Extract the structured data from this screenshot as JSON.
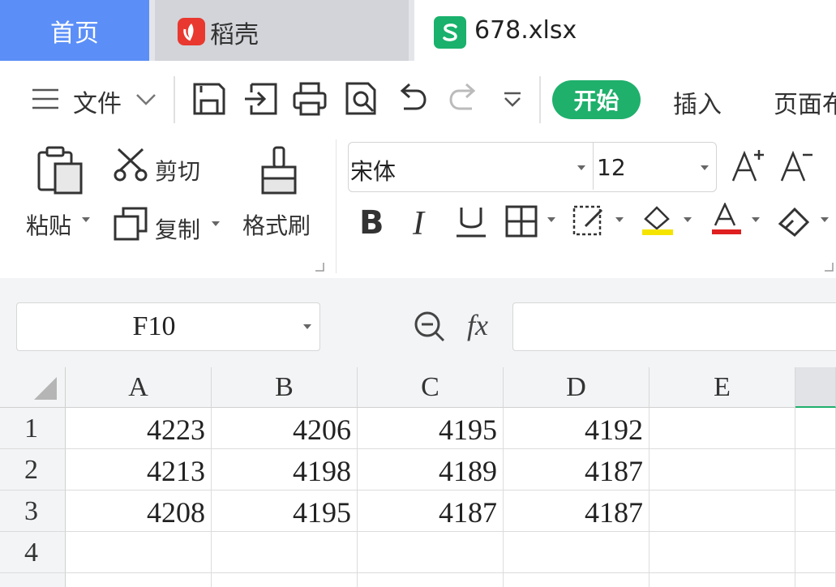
{
  "tabs": {
    "home": "首页",
    "daoke": "稻壳",
    "file": "678.xlsx"
  },
  "toolbar": {
    "file_menu": "文件",
    "start": "开始",
    "insert": "插入",
    "page_layout": "页面布"
  },
  "ribbon": {
    "paste": "粘贴",
    "cut": "剪切",
    "copy": "复制",
    "format_painter": "格式刷",
    "font_name": "宋体",
    "font_size": "12",
    "font_color": "#e02020",
    "fill_color": "#f5e400"
  },
  "formula_bar": {
    "name_box": "F10",
    "fx": "fx",
    "formula": ""
  },
  "grid": {
    "columns": [
      "A",
      "B",
      "C",
      "D",
      "E"
    ],
    "rows": [
      {
        "num": "1",
        "cells": [
          "4223",
          "4206",
          "4195",
          "4192",
          ""
        ]
      },
      {
        "num": "2",
        "cells": [
          "4213",
          "4198",
          "4189",
          "4187",
          ""
        ]
      },
      {
        "num": "3",
        "cells": [
          "4208",
          "4195",
          "4187",
          "4187",
          ""
        ]
      },
      {
        "num": "4",
        "cells": [
          "",
          "",
          "",
          "",
          ""
        ]
      }
    ]
  }
}
